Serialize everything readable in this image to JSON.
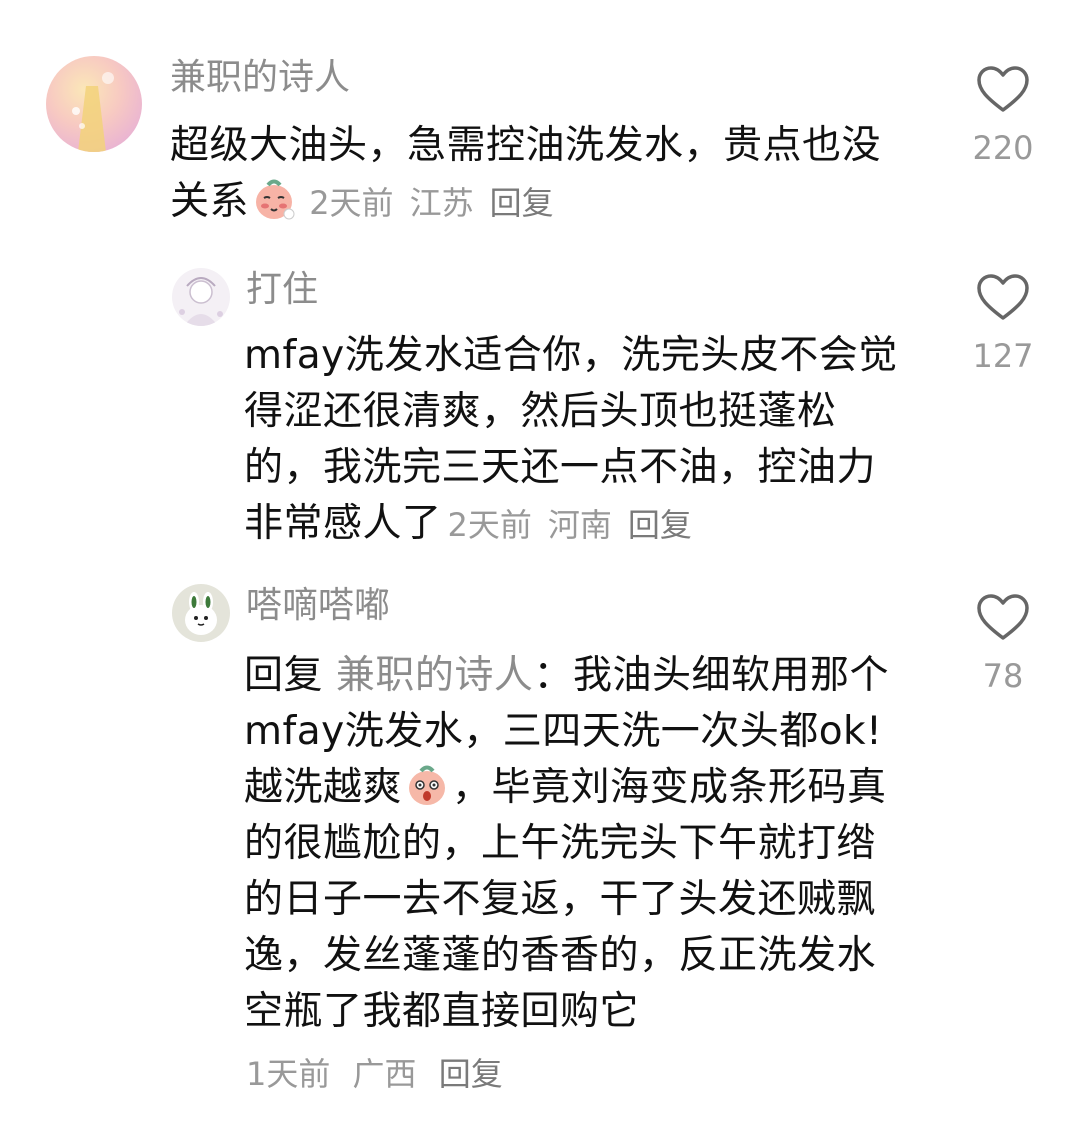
{
  "comments": [
    {
      "username": "兼职的诗人",
      "text_line1": "超级大油头，急需控油洗发水，贵点也没",
      "text_line2": "关系",
      "emoji": "blushing-face-emoji",
      "time": "2天前",
      "location": "江苏",
      "reply_label": "回复",
      "likes": "220",
      "avatar_colors": [
        "#f7c9c2",
        "#f9e2a8",
        "#e8b7d6"
      ]
    },
    {
      "username": "打住",
      "text": "mfay洗发水适合你，洗完头皮不会觉得涩还很清爽，然后头顶也挺蓬松的，我洗完三天还一点不油，控油力非常感人了",
      "time": "2天前",
      "location": "河南",
      "reply_label": "回复",
      "likes": "127",
      "avatar_colors": [
        "#f2eef3",
        "#cbbfd0"
      ]
    },
    {
      "username": "嗒嘀嗒嘟",
      "reply_prefix": "回复",
      "reply_target": "兼职的诗人",
      "text": "：我油头细软用那个mfay洗发水，三四天洗一次头都ok!越洗越爽",
      "emoji": "surprised-face-emoji",
      "text_after_emoji": "，毕竟刘海变成条形码真的很尴尬的，上午洗完头下午就打绺的日子一去不复返，干了头发还贼飘逸，发丝蓬蓬的香香的，反正洗发水空瓶了我都直接回购它",
      "time": "1天前",
      "location": "广西",
      "reply_label": "回复",
      "likes": "78",
      "avatar_colors": [
        "#dcdcd2",
        "#ffffff",
        "#3d7a3a"
      ]
    }
  ],
  "colors": {
    "text": "#111111",
    "secondary": "#999999",
    "username": "#8c8c8c",
    "heart_stroke": "#666666"
  }
}
